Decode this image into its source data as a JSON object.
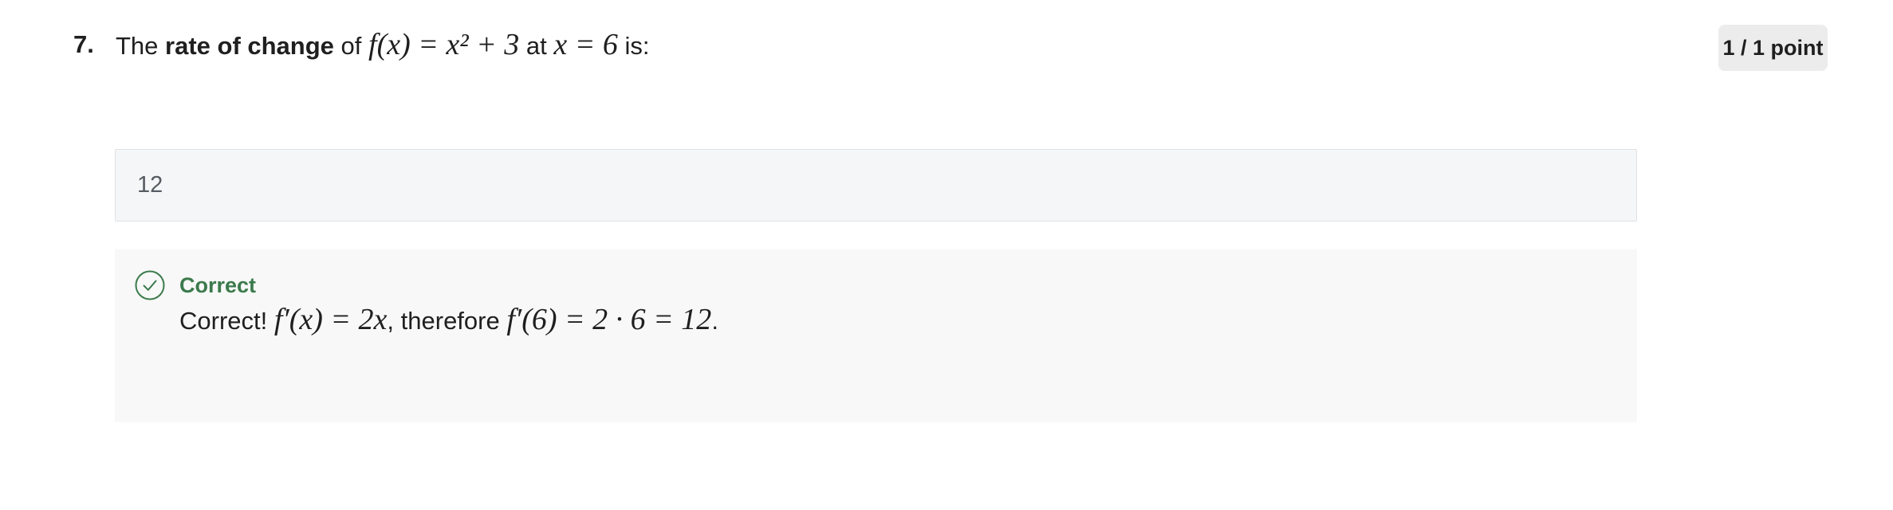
{
  "question": {
    "number": "7.",
    "text_before": "The ",
    "bold_phrase": "rate of change",
    "text_of": " of ",
    "math_function": "f(x) = x² + 3",
    "text_at": " at ",
    "math_point": "x = 6",
    "text_end": " is:"
  },
  "points_badge": "1 / 1 point",
  "answer": {
    "value": "12"
  },
  "feedback": {
    "status": "Correct",
    "text_prefix": "Correct! ",
    "math_derivative": "f′(x) = 2x",
    "text_middle": ", therefore ",
    "math_result": "f′(6) = 2 · 6 = 12",
    "text_end": "."
  },
  "icons": {
    "status_icon": "check-circle-icon"
  },
  "colors": {
    "correct": "#3b7a4c",
    "badge_bg": "#ececec",
    "feedback_bg": "#f7f8f7",
    "answer_bg": "#f5f6f7"
  }
}
